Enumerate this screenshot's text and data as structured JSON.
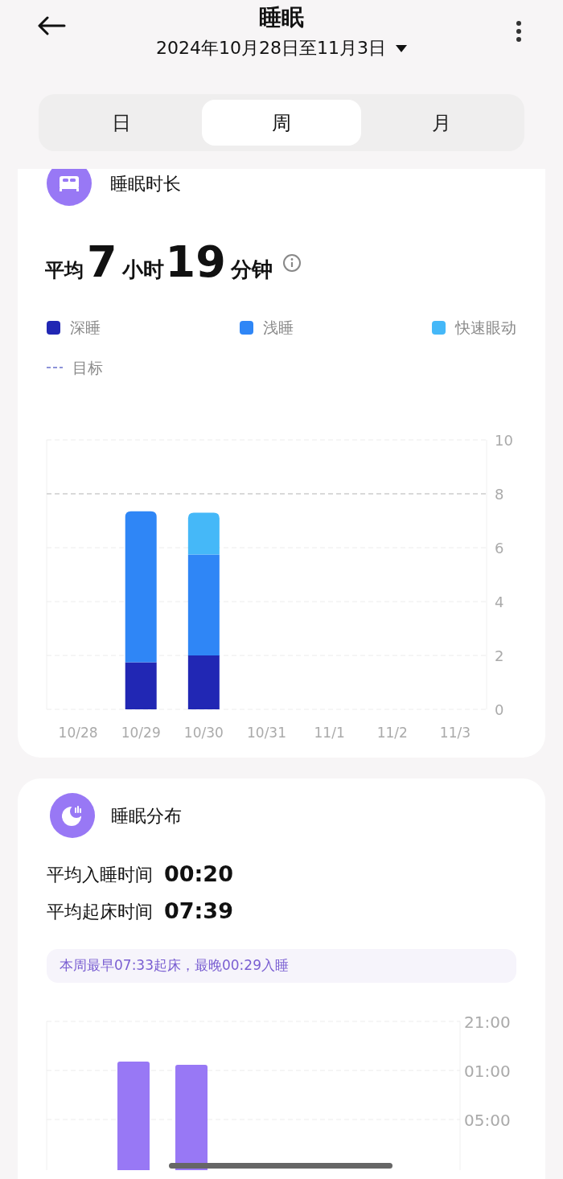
{
  "header": {
    "title": "睡眠",
    "date_range": "2024年10月28日至11月3日"
  },
  "tabs": [
    {
      "label": "日",
      "selected": false
    },
    {
      "label": "周",
      "selected": true
    },
    {
      "label": "月",
      "selected": false
    }
  ],
  "duration_card": {
    "title": "睡眠时长",
    "average": [
      {
        "kind": "label",
        "text": "平均"
      },
      {
        "kind": "number",
        "text": "7"
      },
      {
        "kind": "unit",
        "text": "小时"
      },
      {
        "kind": "number",
        "text": "19"
      },
      {
        "kind": "unit",
        "text": "分钟"
      }
    ],
    "goal_legend": {
      "label": "目标",
      "color": "#8d93d8"
    },
    "chart_data": {
      "type": "bar",
      "stacked": true,
      "categories": [
        "10/28",
        "10/29",
        "10/30",
        "10/31",
        "11/1",
        "11/2",
        "11/3"
      ],
      "series": [
        {
          "name": "深睡",
          "color": "#2127b4",
          "values": [
            null,
            1.75,
            2.0,
            null,
            null,
            null,
            null
          ]
        },
        {
          "name": "浅睡",
          "color": "#2f86f6",
          "values": [
            null,
            5.6,
            3.75,
            null,
            null,
            null,
            null
          ]
        },
        {
          "name": "快速眼动",
          "color": "#45b8f8",
          "values": [
            null,
            0,
            1.55,
            null,
            null,
            null,
            null
          ]
        }
      ],
      "ylim": [
        0,
        10
      ],
      "yticks": [
        0,
        2,
        4,
        6,
        8,
        10
      ],
      "grid": true,
      "ref_lines": [
        {
          "axis": "y",
          "value": 8
        }
      ]
    }
  },
  "distribution_card": {
    "title": "睡眠分布",
    "stats": [
      {
        "label": "平均入睡时间",
        "value": "00:20"
      },
      {
        "label": "平均起床时间",
        "value": "07:39"
      }
    ],
    "note": "本周最早07:33起床，最晚00:29入睡",
    "time_axis_labels": [
      "21:00",
      "01:00",
      "05:00"
    ]
  }
}
